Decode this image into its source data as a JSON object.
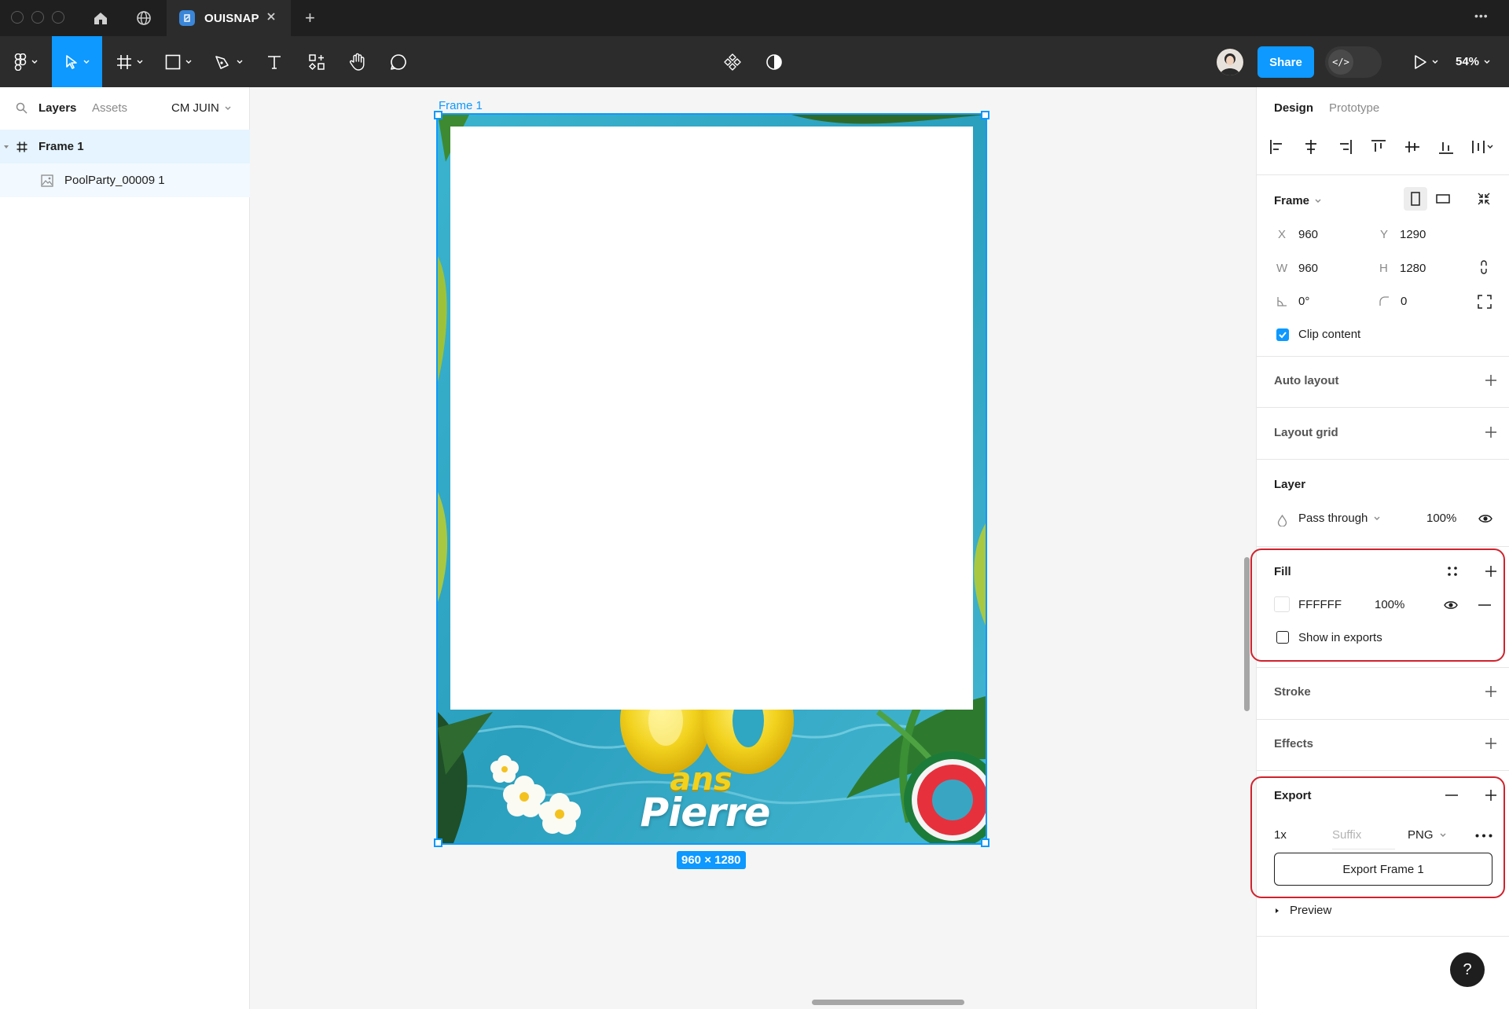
{
  "titlebar": {
    "tab_title": "OUISNAP",
    "new_tab": "+",
    "more": "•••"
  },
  "toolbar": {
    "share_label": "Share",
    "dev_mode_label": "</>",
    "zoom_label": "54%"
  },
  "left_panel": {
    "tabs": [
      "Layers",
      "Assets"
    ],
    "page_selector": "CM JUIN",
    "layers": [
      {
        "name": "Frame 1",
        "type": "frame"
      },
      {
        "name": "PoolParty_00009 1",
        "type": "image"
      }
    ]
  },
  "canvas": {
    "frame_label": "Frame 1",
    "size_badge": "960 × 1280",
    "artwork": {
      "number": "30",
      "word": "ans",
      "name": "Pierre"
    }
  },
  "right_panel": {
    "tabs": [
      "Design",
      "Prototype"
    ],
    "frame": {
      "title": "Frame",
      "x_label": "X",
      "x_value": "960",
      "y_label": "Y",
      "y_value": "1290",
      "w_label": "W",
      "w_value": "960",
      "h_label": "H",
      "h_value": "1280",
      "rotation_value": "0°",
      "radius_value": "0",
      "clip_content_label": "Clip content",
      "clip_content_checked": true
    },
    "auto_layout": "Auto layout",
    "layout_grid": "Layout grid",
    "layer": {
      "title": "Layer",
      "blend_mode": "Pass through",
      "opacity": "100%"
    },
    "fill": {
      "title": "Fill",
      "hex": "FFFFFF",
      "opacity": "100%",
      "show_in_exports_label": "Show in exports",
      "show_in_exports_checked": false
    },
    "stroke": "Stroke",
    "effects": "Effects",
    "export": {
      "title": "Export",
      "scale": "1x",
      "suffix_placeholder": "Suffix",
      "format": "PNG",
      "button_label": "Export Frame 1",
      "preview_label": "Preview"
    },
    "help_label": "?"
  },
  "colors": {
    "accent": "#0d99ff",
    "highlight": "#d0222d",
    "toolbar_bg": "#2c2c2c",
    "titlebar_bg": "#1f1f1f"
  }
}
